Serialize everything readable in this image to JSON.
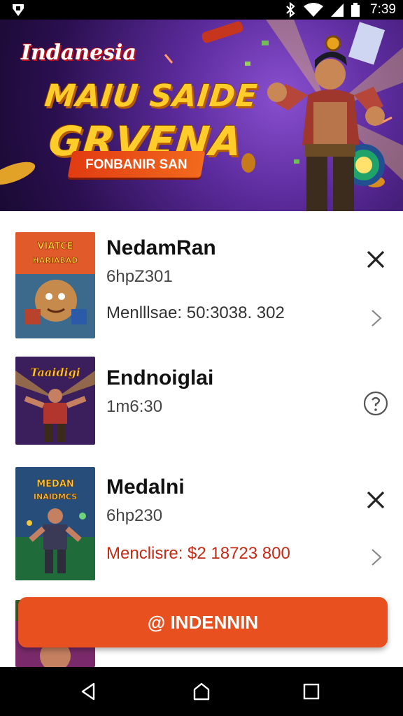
{
  "status_bar": {
    "time": "7:39",
    "left_icon": "app-notification-icon",
    "right_icons": [
      "bluetooth-icon",
      "wifi-icon",
      "signal-icon",
      "battery-icon"
    ]
  },
  "banner": {
    "brand": "Indanesia",
    "headline_line1": "MAIU SAIDE",
    "headline_line2": "GRVENA",
    "ribbon": "FONBANIR SAN"
  },
  "items": [
    {
      "title": "NedamRan",
      "subtitle": "6hpZ301",
      "price": "Menlllsae: 50:3038. 302",
      "action_icon": "close-icon",
      "nav_icon": "chevron-right-icon",
      "thumb_text": "VIATCE HARIABAD"
    },
    {
      "title": "Endnoiglai",
      "subtitle": "1m6:30",
      "price": "",
      "action_icon": "info-circle-icon",
      "thumb_text": "Taaidigi"
    },
    {
      "title": "Medalni",
      "subtitle": "6hp230",
      "price": "Menclisre: $2 18723 800",
      "action_icon": "close-icon",
      "nav_icon": "chevron-right-icon",
      "thumb_text": "MEDAN INAIDMCS"
    }
  ],
  "cta": {
    "icon": "at-icon",
    "label": "@ INDENNIN"
  },
  "colors": {
    "accent": "#e8501f",
    "price_red": "#c42a16",
    "banner_bg": "#5a2a9a"
  },
  "nav_bar": {
    "back": "back-icon",
    "home": "home-icon",
    "recents": "recents-icon"
  }
}
